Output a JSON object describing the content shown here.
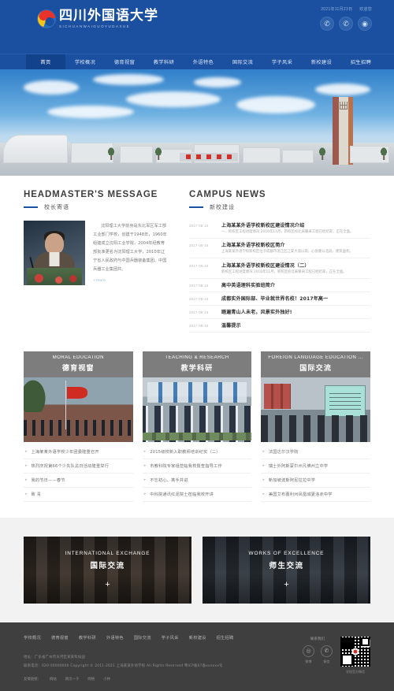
{
  "header": {
    "logo_cn": "四川外国语大学",
    "logo_en": "SICHUANWAIGUOYUDAXUE",
    "date_text": "2021年11月23日",
    "welcome_text": "欢迎您",
    "social": [
      {
        "name": "phone-icon",
        "glyph": "✆"
      },
      {
        "name": "wechat-icon",
        "glyph": "✆"
      },
      {
        "name": "weibo-icon",
        "glyph": "◉"
      }
    ]
  },
  "nav": {
    "items": [
      {
        "label": "首页",
        "active": true
      },
      {
        "label": "学校概况",
        "active": false
      },
      {
        "label": "德育视窗",
        "active": false
      },
      {
        "label": "教学科研",
        "active": false
      },
      {
        "label": "外语特色",
        "active": false
      },
      {
        "label": "国际交流",
        "active": false
      },
      {
        "label": "学子风采",
        "active": false
      },
      {
        "label": "新校建设",
        "active": false
      },
      {
        "label": "招生招聘",
        "active": false
      }
    ]
  },
  "headmaster": {
    "title_en": "HEADMASTER'S MESSAGE",
    "title_cn": "校长寄语",
    "body": "沈阳理工大学前身是东北军区军工部工业部门学校，创建于1948年，1960年组建成立沈阳工业学院，2004年经教育部批准更名为沈阳理工大学，2010年辽宁省人民政府与中国兵器装备集团、中国兵器工业集团共。",
    "more_label": "+more"
  },
  "news": {
    "title_en": "CAMPUS NEWS",
    "title_cn": "新校建设",
    "items": [
      {
        "date": "2017-08-15",
        "title": "上海某某外语学校新校区建设情况介绍",
        "sub": "一、新校区工程进度情况 2016年11月，新校区校北采暖采工程已经结束，正在全面。"
      },
      {
        "date": "2017-08-15",
        "title": "上海某某外语学校新校区简介",
        "sub": "上海某某外语学校新校区位于成都市温江区江安大道以南，心悦路以北段，建筑面积。"
      },
      {
        "date": "2017-08-15",
        "title": "上海某某外语学校新校区建设情况（二）",
        "sub": "新校区工程进度情况 2016年11月，新校区校北采暖采工程已经结束，正在全面。"
      },
      {
        "date": "2017-08-15",
        "title": "高中英语理科实验班简介",
        "sub": ""
      },
      {
        "date": "2017-08-15",
        "title": "成都实外国际部、毕业就世界名校！2017年高一",
        "sub": ""
      },
      {
        "date": "2017-08-15",
        "title": "踏遍青山人未老，风景实外独好!",
        "sub": ""
      },
      {
        "date": "2017-08-15",
        "title": "温馨提示",
        "sub": ""
      }
    ]
  },
  "cards": [
    {
      "en": "MORAL EDUCATION",
      "cn": "德育视窗",
      "image": "flag-raising-ceremony-photo",
      "links": [
        "上海某某外语学校少年团委隆重召开",
        "热烈庆祝第66个少先队总日活动隆重举行",
        "我的节日——春节",
        "致 青"
      ]
    },
    {
      "en": "TEACHING & RESEARCH",
      "cn": "教学科研",
      "image": "classroom-students-photo",
      "links": [
        "2015级校新入职教师培训纪实（二）",
        "市教科院专家组莅临我校督查指导工作",
        "不忘初心、携手并进",
        "中科院通讯红泥院士莅临我校开讲"
      ]
    },
    {
      "en": "FOREIGN LANGUAGE EDUCATION ...",
      "cn": "国际交流",
      "image": "presentation-lecture-photo",
      "links": [
        "法国达尔汉学院",
        "瑞士外阿斯蒙尔州凡佛州立中学",
        "新加坡波斯阿尼拉拉中学",
        "美国艾布蕾利州凤凰城夏洛赤中学"
      ]
    }
  ],
  "banners": [
    {
      "en": "INTERNATIONAL EXCHANGE",
      "cn": "国际交流",
      "plus": "+",
      "image": "students-studying-photo"
    },
    {
      "en": "WORKS OF EXCELLENCE",
      "cn": "师生交流",
      "plus": "+",
      "image": "classroom-uniform-students-photo"
    }
  ],
  "footer": {
    "nav": [
      "学校概况",
      "德育视窗",
      "教学科研",
      "外语特色",
      "国际交流",
      "学子风采",
      "新校建设",
      "招生招聘"
    ],
    "address_line": "地址：广东省广州市天河区某某科技园",
    "copyright_line": "联系电话：020-00000000 Copyright © 2011-2021 上海某某外语学校 All Rights Reserved    粤ICP备07备xxxxxx号",
    "friend_label": "友情链接：",
    "friend_links": [
      "网站",
      "网页一于",
      "网络",
      "小林"
    ],
    "contact_label": "联系我们",
    "icons": [
      {
        "label": "微博",
        "name": "weibo-icon",
        "glyph": "◎"
      },
      {
        "label": "微信",
        "name": "wechat-icon",
        "glyph": "✆"
      }
    ],
    "qr_label": "学校官方微信"
  }
}
